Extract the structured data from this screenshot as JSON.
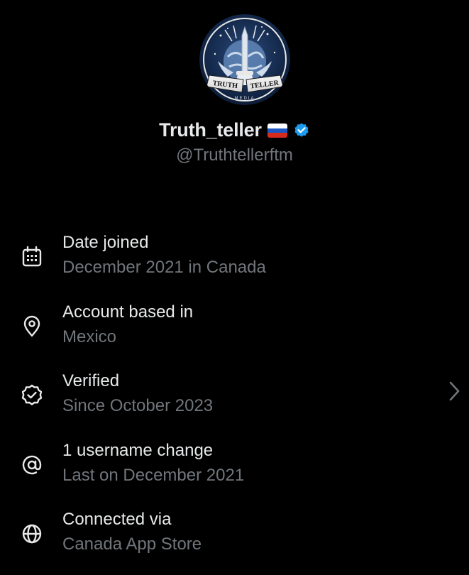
{
  "profile": {
    "display_name": "Truth_teller",
    "handle": "@Truthtellerftm",
    "flag_icon": "russia-flag-icon",
    "badge_icon": "verified-badge-icon",
    "badge_color": "#1d9bf0",
    "avatar_text": {
      "left_ribbon": "TRUTH",
      "right_ribbon": "TELLER",
      "bottom": "MEDIA"
    }
  },
  "info": [
    {
      "icon": "calendar-icon",
      "title": "Date joined",
      "subtitle": "December 2021 in Canada"
    },
    {
      "icon": "location-pin-icon",
      "title": "Account based in",
      "subtitle": "Mexico"
    },
    {
      "icon": "verified-check-icon",
      "title": "Verified",
      "subtitle": "Since October 2023",
      "chevron": "chevron-right-icon"
    },
    {
      "icon": "at-sign-icon",
      "title": "1 username change",
      "subtitle": "Last on December 2021"
    },
    {
      "icon": "globe-icon",
      "title": "Connected via",
      "subtitle": "Canada App Store"
    }
  ],
  "colors": {
    "background": "#000000",
    "primary_text": "#e7e9ea",
    "secondary_text": "#71767b"
  }
}
